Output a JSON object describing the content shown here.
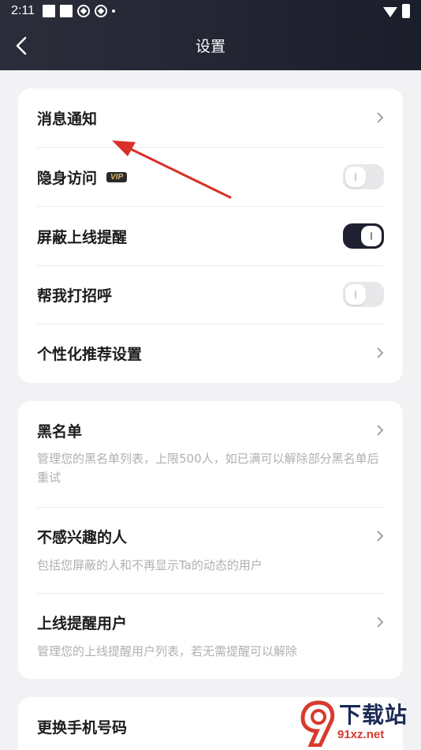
{
  "status_bar": {
    "time": "2:11"
  },
  "header": {
    "title": "设置"
  },
  "card1": {
    "items": [
      {
        "label": "消息通知"
      },
      {
        "label": "隐身访问",
        "badge": "VIP",
        "toggle": false
      },
      {
        "label": "屏蔽上线提醒",
        "toggle": true
      },
      {
        "label": "帮我打招呼",
        "toggle": false
      },
      {
        "label": "个性化推荐设置"
      }
    ]
  },
  "card2": {
    "items": [
      {
        "label": "黑名单",
        "desc": "管理您的黑名单列表，上限500人，如已满可以解除部分黑名单后重试"
      },
      {
        "label": "不感兴趣的人",
        "desc": "包括您屏蔽的人和不再显示Ta的动态的用户"
      },
      {
        "label": "上线提醒用户",
        "desc": "管理您的上线提醒用户列表，若无需提醒可以解除"
      }
    ]
  },
  "card3": {
    "items": [
      {
        "label": "更换手机号码"
      }
    ]
  },
  "watermark": {
    "top": "下载站",
    "bottom": "91xz.net"
  },
  "colors": {
    "accent": "#1f2130",
    "annotation": "#d9302a"
  }
}
